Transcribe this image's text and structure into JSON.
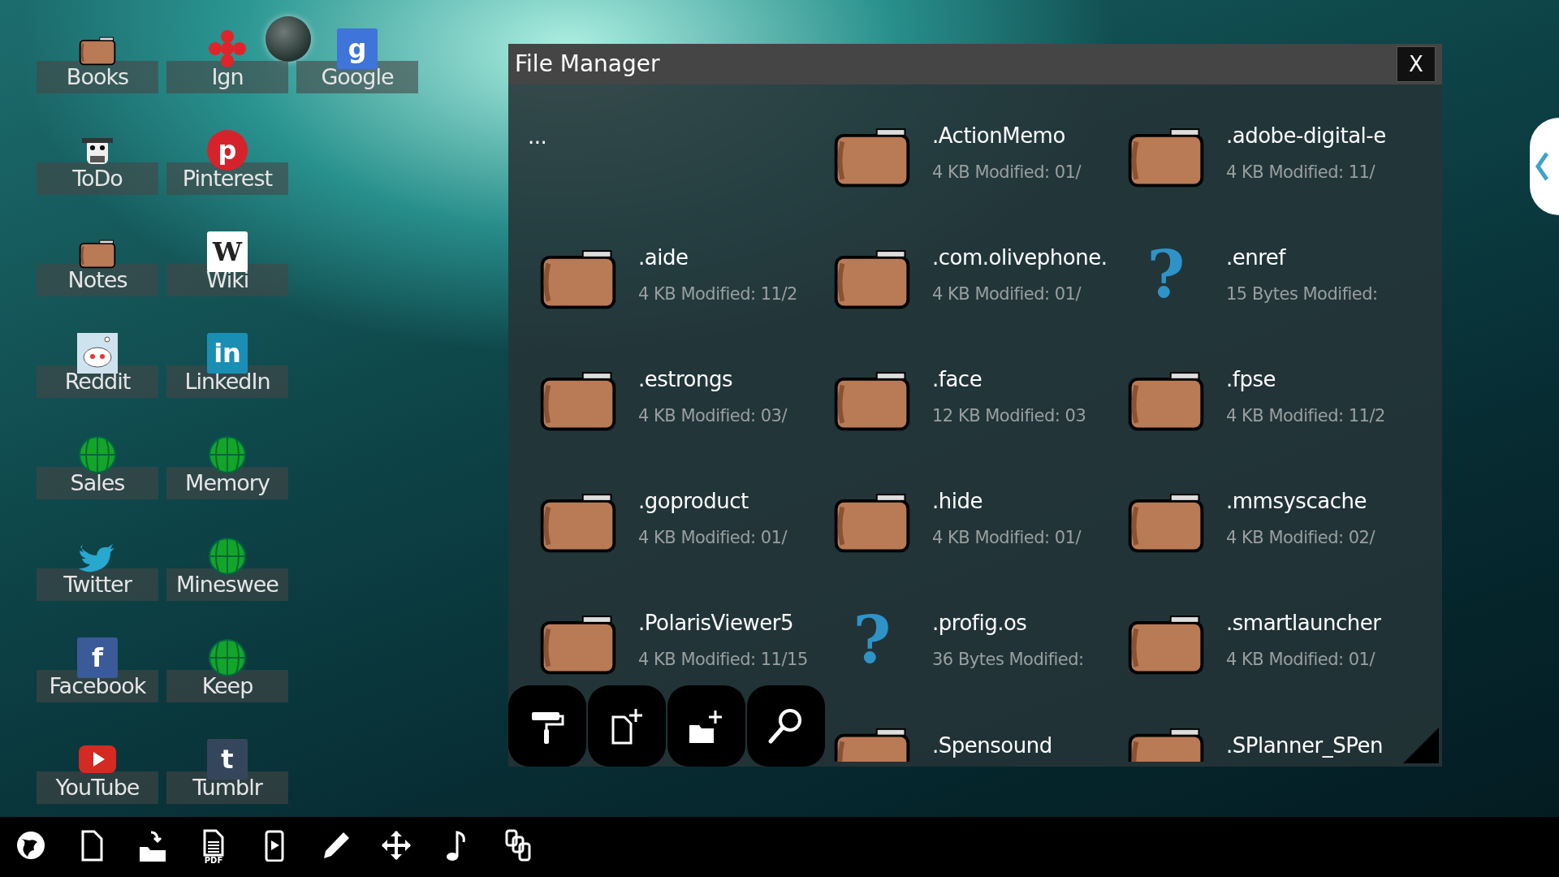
{
  "desktop": {
    "rows": [
      [
        {
          "label": "Books",
          "kind": "folder"
        },
        {
          "label": "Ign",
          "kind": "ign"
        },
        {
          "label": "Google",
          "kind": "google",
          "glyph": "g"
        }
      ],
      [
        {
          "label": "ToDo",
          "kind": "cow"
        },
        {
          "label": "Pinterest",
          "kind": "pinterest",
          "glyph": "p"
        }
      ],
      [
        {
          "label": "Notes",
          "kind": "folder"
        },
        {
          "label": "Wiki",
          "kind": "wiki",
          "glyph": "W"
        }
      ],
      [
        {
          "label": "Reddit",
          "kind": "reddit"
        },
        {
          "label": "LinkedIn",
          "kind": "linkedin",
          "glyph": "in"
        }
      ],
      [
        {
          "label": "Sales",
          "kind": "globe"
        },
        {
          "label": "Memory",
          "kind": "globe"
        }
      ],
      [
        {
          "label": "Twitter",
          "kind": "bird"
        },
        {
          "label": "Mineswee",
          "kind": "globe"
        }
      ],
      [
        {
          "label": "Facebook",
          "kind": "facebook",
          "glyph": "f"
        },
        {
          "label": "Keep",
          "kind": "globe"
        }
      ],
      [
        {
          "label": "YouTube",
          "kind": "youtube"
        },
        {
          "label": "Tumblr",
          "kind": "tumblr",
          "glyph": "t"
        }
      ]
    ]
  },
  "file_manager": {
    "title": "File Manager",
    "close": "X",
    "items": [
      {
        "kind": "parent",
        "name": "..."
      },
      {
        "kind": "folder",
        "name": ".ActionMemo",
        "meta": "4 KB Modified: 01/"
      },
      {
        "kind": "folder",
        "name": ".adobe-digital-e",
        "meta": "4 KB Modified: 11/"
      },
      {
        "kind": "folder",
        "name": ".aide",
        "meta": "4 KB Modified: 11/2"
      },
      {
        "kind": "folder",
        "name": ".com.olivephone.",
        "meta": "4 KB Modified: 01/"
      },
      {
        "kind": "unknown",
        "glyph": "?",
        "name": ".enref",
        "meta": "15 Bytes Modified:"
      },
      {
        "kind": "folder",
        "name": ".estrongs",
        "meta": "4 KB Modified: 03/"
      },
      {
        "kind": "folder",
        "name": ".face",
        "meta": "12 KB Modified: 03"
      },
      {
        "kind": "folder",
        "name": ".fpse",
        "meta": "4 KB Modified: 11/2"
      },
      {
        "kind": "folder",
        "name": ".goproduct",
        "meta": "4 KB Modified: 01/"
      },
      {
        "kind": "folder",
        "name": ".hide",
        "meta": "4 KB Modified: 01/"
      },
      {
        "kind": "folder",
        "name": ".mmsyscache",
        "meta": "4 KB Modified: 02/"
      },
      {
        "kind": "folder",
        "name": ".PolarisViewer5",
        "meta": "4 KB Modified: 11/15"
      },
      {
        "kind": "unknown",
        "glyph": "?",
        "name": ".profig.os",
        "meta": "36 Bytes Modified:"
      },
      {
        "kind": "folder",
        "name": ".smartlauncher",
        "meta": "4 KB Modified: 01/"
      },
      {
        "kind": "covered"
      },
      {
        "kind": "folder",
        "name": ".Spensound"
      },
      {
        "kind": "folder",
        "name": ".SPlanner_SPen"
      }
    ],
    "tools": [
      {
        "kind": "roller"
      },
      {
        "kind": "new-file"
      },
      {
        "kind": "new-folder"
      },
      {
        "kind": "search"
      }
    ]
  },
  "taskbar": [
    {
      "kind": "globe"
    },
    {
      "kind": "file"
    },
    {
      "kind": "import"
    },
    {
      "kind": "pdf",
      "label": "PDF"
    },
    {
      "kind": "phone"
    },
    {
      "kind": "pencil"
    },
    {
      "kind": "move"
    },
    {
      "kind": "music"
    },
    {
      "kind": "copy"
    }
  ]
}
